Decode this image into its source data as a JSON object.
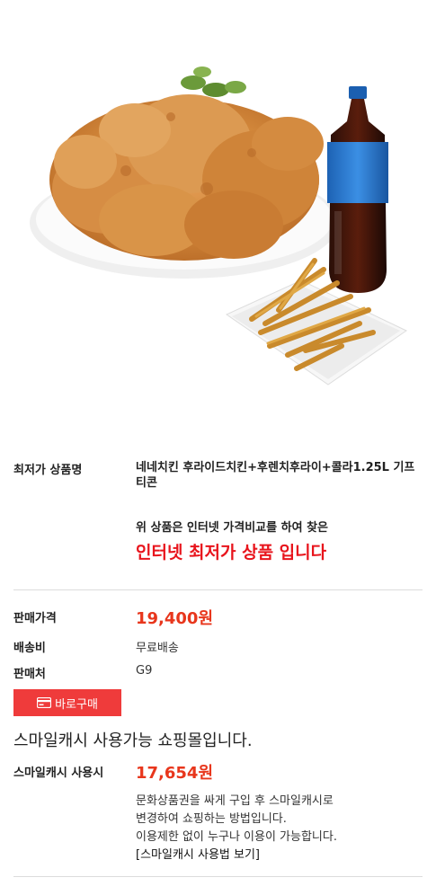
{
  "product": {
    "name_label": "최저가 상품명",
    "name_value": "네네치킨 후라이드치킨+후렌치후라이+콜라1.25L 기프티콘",
    "image_name": "fried-chicken-fries-cola"
  },
  "notice": {
    "line1": "위 상품은 인터넷 가격비교를 하여 찾은",
    "line2": "인터넷 최저가 상품 입니다"
  },
  "pricing": {
    "price_label": "판매가격",
    "price_value": "19,400원",
    "shipping_label": "배송비",
    "shipping_value": "무료배송",
    "seller_label": "판매처",
    "seller_value": "G9"
  },
  "buy_button": {
    "label": "바로구매",
    "icon": "card-icon"
  },
  "smilecash": {
    "title": "스마일캐시 사용가능 쇼핑몰입니다.",
    "label": "스마일캐시 사용시",
    "value": "17,654원",
    "desc1": "문화상품권을 싸게 구입 후 스마일캐시로",
    "desc2": "변경하여 쇼핑하는 방법입니다.",
    "desc3": "이용제한 없이 누구나 이용이 가능합니다.",
    "link": "[스마일캐시 사용법 보기]"
  },
  "colors": {
    "accent_red": "#e8141c",
    "price_orange_red": "#e8361c",
    "button_red": "#ef3b3b"
  }
}
